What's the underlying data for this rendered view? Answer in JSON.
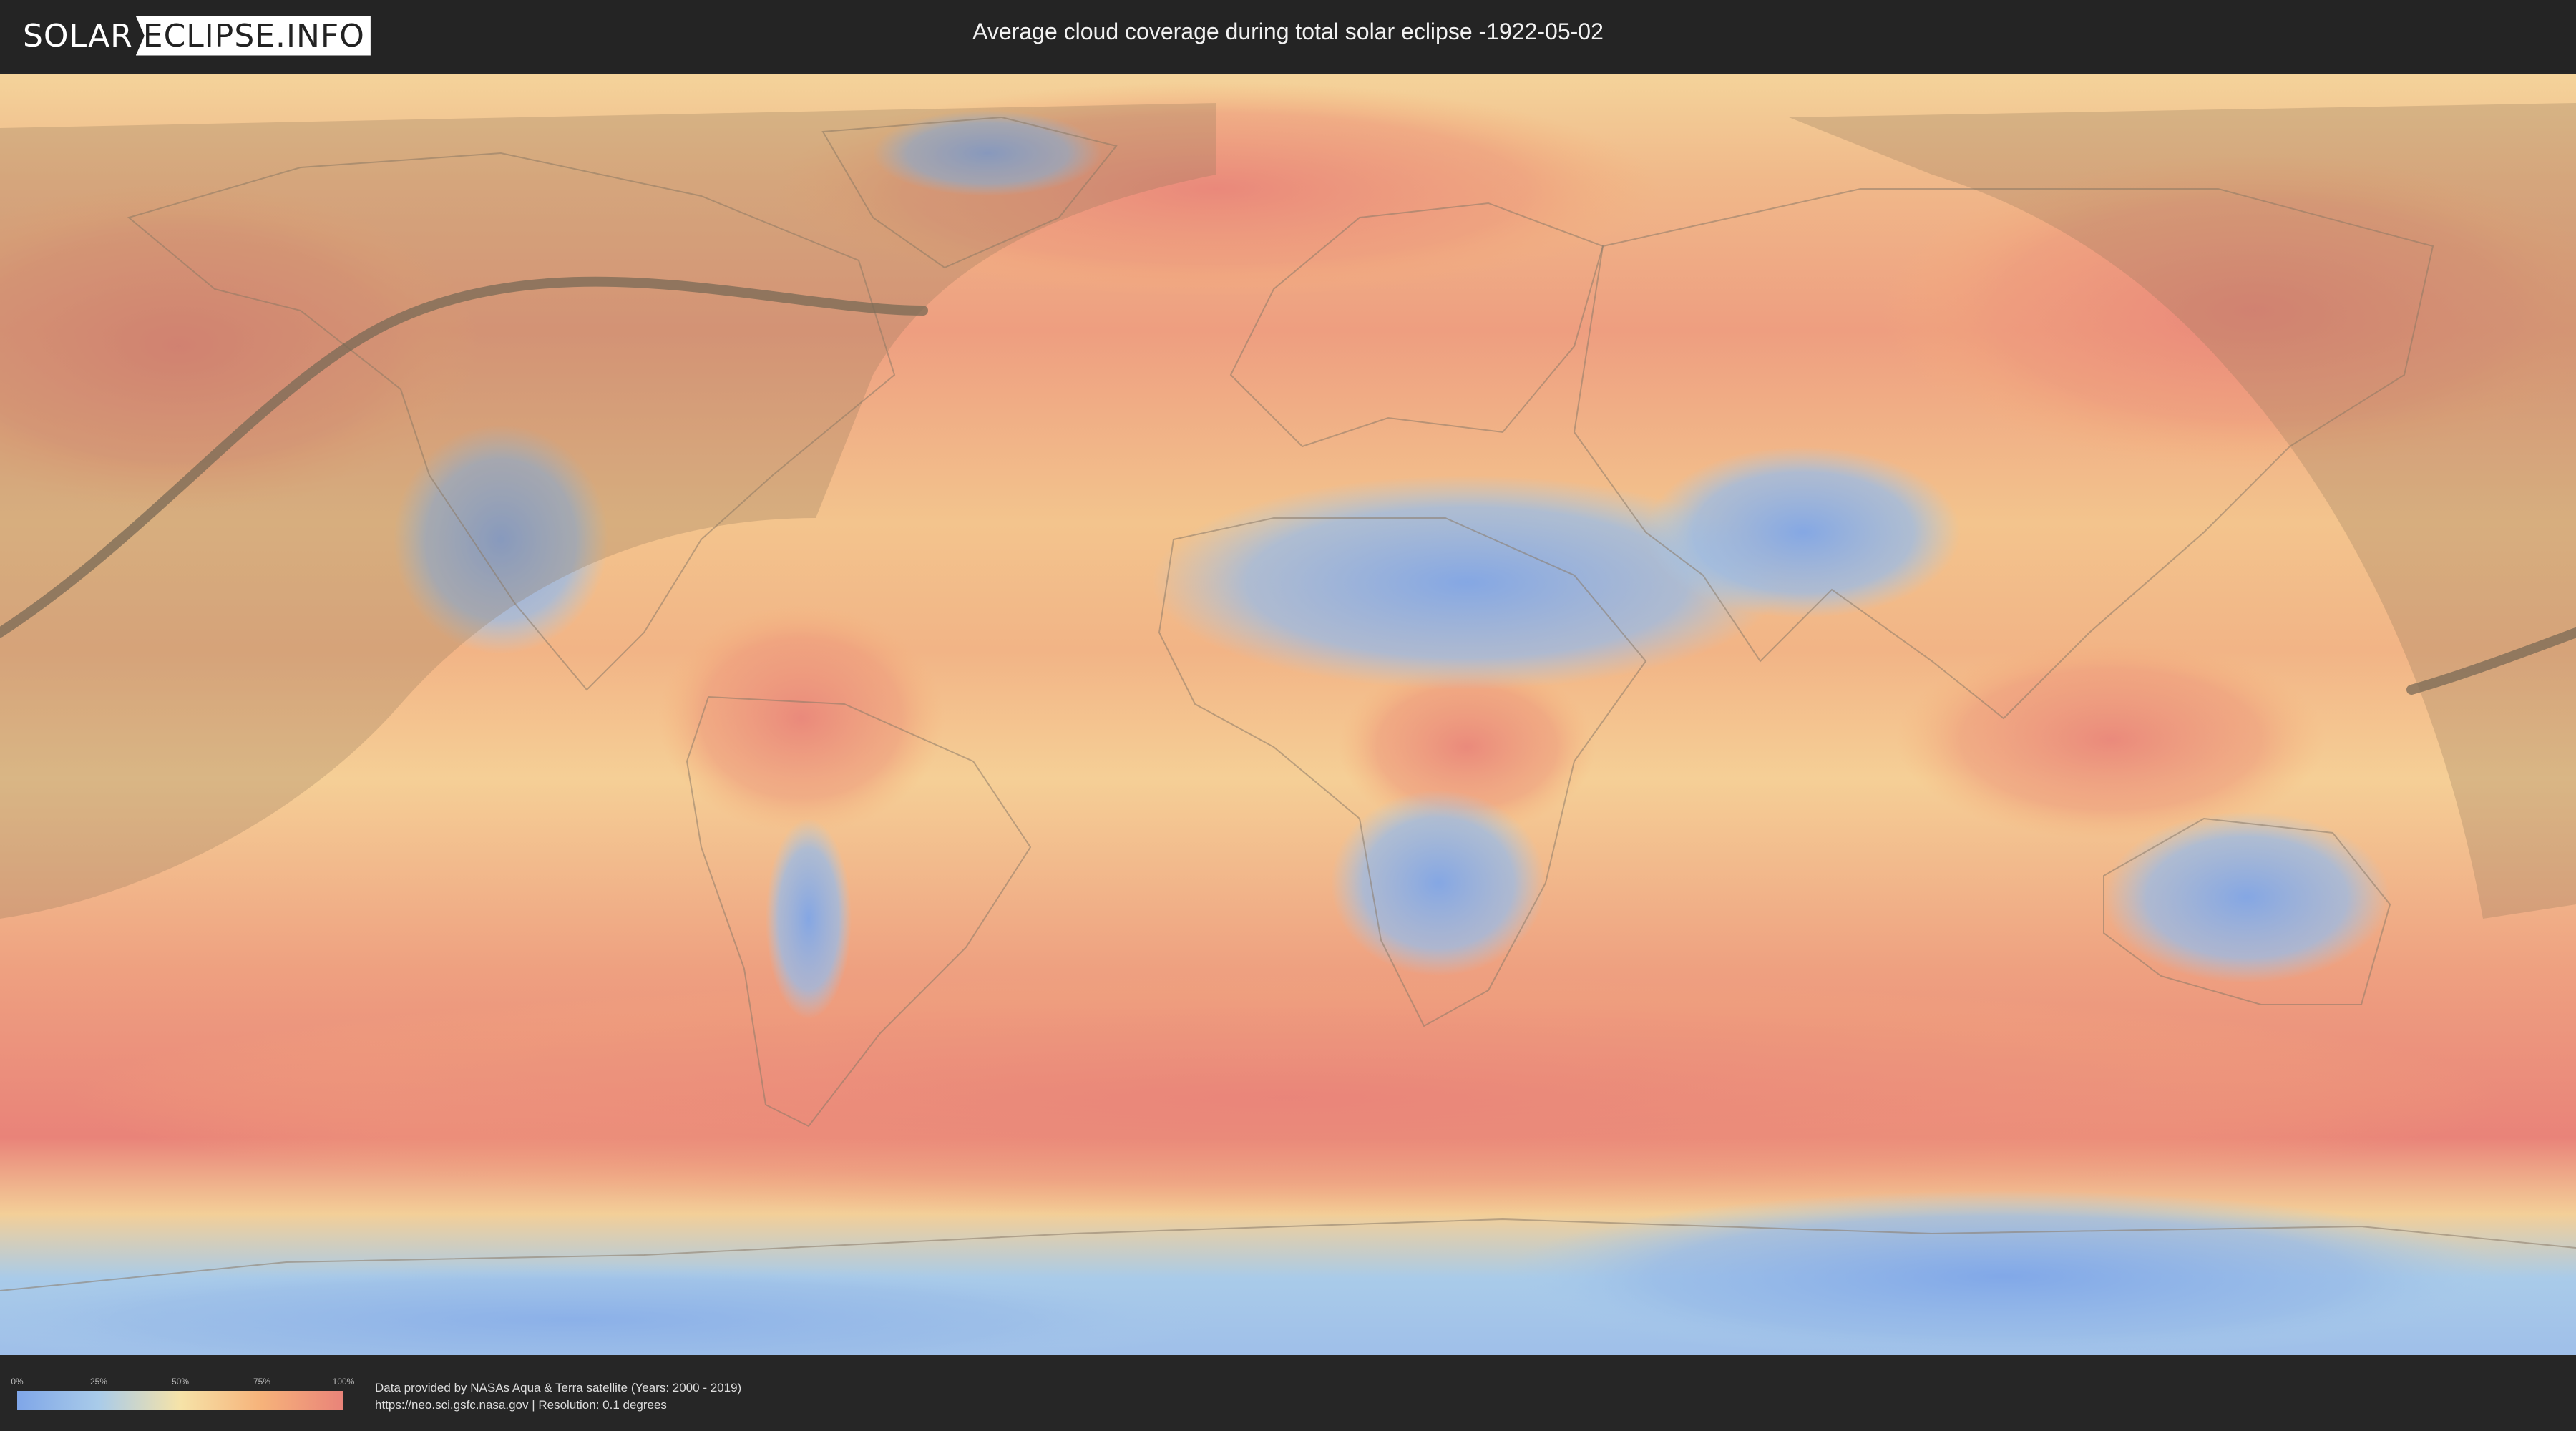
{
  "header": {
    "logo_left": "SOLAR",
    "logo_right": "ECLIPSE.INFO",
    "title": "Average cloud coverage during total solar eclipse -1922-05-02"
  },
  "map": {
    "colors": {
      "clear": "#7fa6e8",
      "low": "#a9cbe9",
      "mid": "#f6e3a8",
      "high": "#f6b27a",
      "overcast": "#e98379",
      "night_shade": "#a08560",
      "eclipse_path": "#7a6a55"
    }
  },
  "legend": {
    "ticks": [
      "0%",
      "25%",
      "50%",
      "75%",
      "100%"
    ]
  },
  "footer": {
    "source_line1": "Data provided by NASAs Aqua & Terra satellite (Years: 2000 - 2019)",
    "source_line2": "https://neo.sci.gsfc.nasa.gov | Resolution: 0.1 degrees"
  }
}
